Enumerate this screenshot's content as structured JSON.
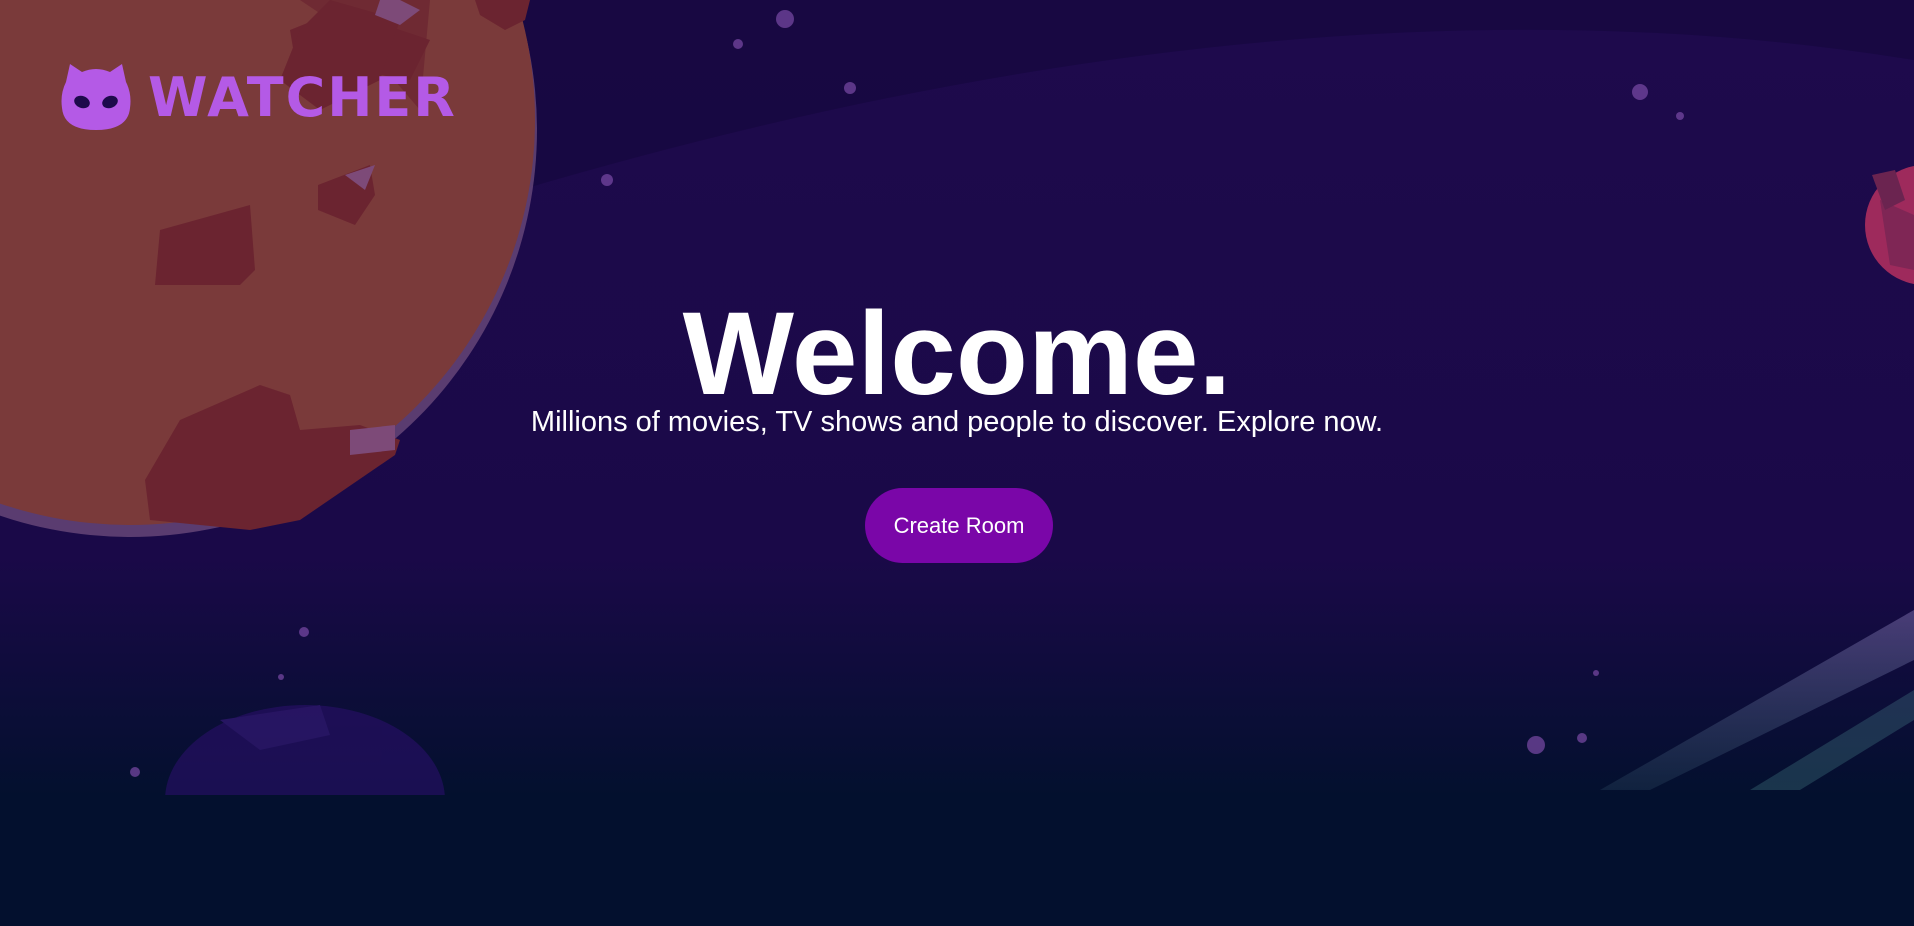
{
  "brand": {
    "name": "WATCHER",
    "color": "#b45ae6",
    "logo_icon": "cat-mask-icon"
  },
  "hero": {
    "title": "Welcome.",
    "subtitle": "Millions of movies, TV shows and people to discover. Explore now.",
    "cta_label": "Create Room",
    "cta_color": "#7a06a8"
  },
  "theme": {
    "sky_top": "#1e0a4c",
    "sky_bottom": "#03102e",
    "planet_color": "#7a3a3a",
    "crater_color": "#6b2430",
    "small_planet_color": "#9e2a5c"
  }
}
